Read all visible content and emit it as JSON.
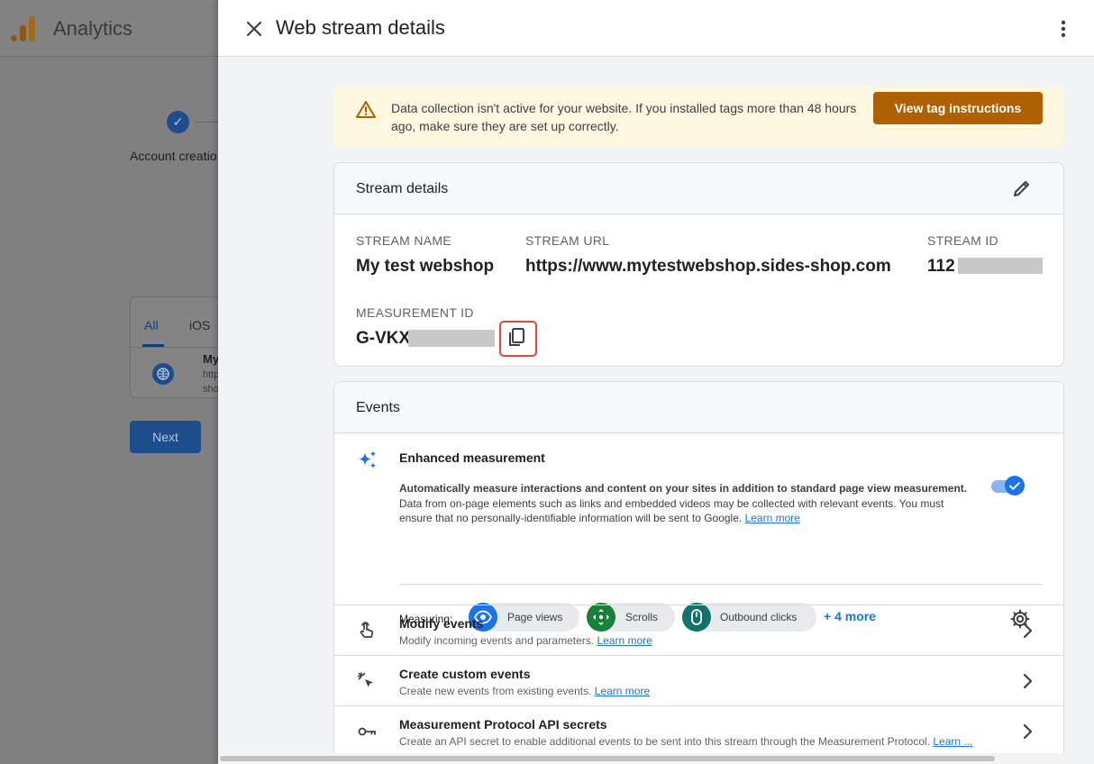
{
  "background": {
    "app_title": "Analytics",
    "step_label": "Account creatio",
    "tabs": [
      "All",
      "iOS"
    ],
    "row_title": "My",
    "row_sub1": "http",
    "row_sub2": "sho",
    "next_label": "Next"
  },
  "panel": {
    "title": "Web stream details",
    "icons": {
      "close": "close-icon",
      "menu": "more-vert-icon"
    }
  },
  "alert": {
    "text": "Data collection isn't active for your website. If you installed tags more than 48 hours ago, make sure they are set up correctly.",
    "button_label": "View tag instructions",
    "icon": "warning-icon"
  },
  "stream_details": {
    "header": "Stream details",
    "stream_name_label": "STREAM NAME",
    "stream_name": "My test webshop",
    "stream_url_label": "STREAM URL",
    "stream_url": "https://www.mytestwebshop.sides-shop.com",
    "stream_id_label": "STREAM ID",
    "stream_id_visible": "112",
    "measurement_id_label": "MEASUREMENT ID",
    "measurement_id_visible": "G-VKX"
  },
  "events": {
    "header": "Events",
    "enhanced": {
      "title": "Enhanced measurement",
      "desc_strong": "Automatically measure interactions and content on your sites in addition to standard page view measurement.",
      "desc": "Data from on-page elements such as links and embedded videos may be collected with relevant events. You must ensure that no personally-identifiable information will be sent to Google.",
      "learn_more": "Learn more",
      "toggle_on": true,
      "measuring_label": "Measuring:",
      "chips": [
        {
          "label": "Page views",
          "icon": "eye-icon",
          "color": "#1a73e8"
        },
        {
          "label": "Scrolls",
          "icon": "scroll-icon",
          "color": "#188038"
        },
        {
          "label": "Outbound clicks",
          "icon": "mouse-icon",
          "color": "#12736b"
        }
      ],
      "more": "+ 4 more"
    },
    "rows": [
      {
        "title": "Modify events",
        "sub": "Modify incoming events and parameters.",
        "link": "Learn more",
        "icon": "touch-icon"
      },
      {
        "title": "Create custom events",
        "sub": "Create new events from existing events.",
        "link": "Learn more",
        "icon": "cursor-click-icon"
      },
      {
        "title": "Measurement Protocol API secrets",
        "sub": "Create an API secret to enable additional events to be sent into this stream through the Measurement Protocol.",
        "link": "Learn ...",
        "icon": "key-icon"
      }
    ]
  },
  "colors": {
    "accent": "#1a73e8",
    "alert_bg": "#fef7e0",
    "alert_button": "#b06000",
    "highlight_border": "#ea4335"
  }
}
